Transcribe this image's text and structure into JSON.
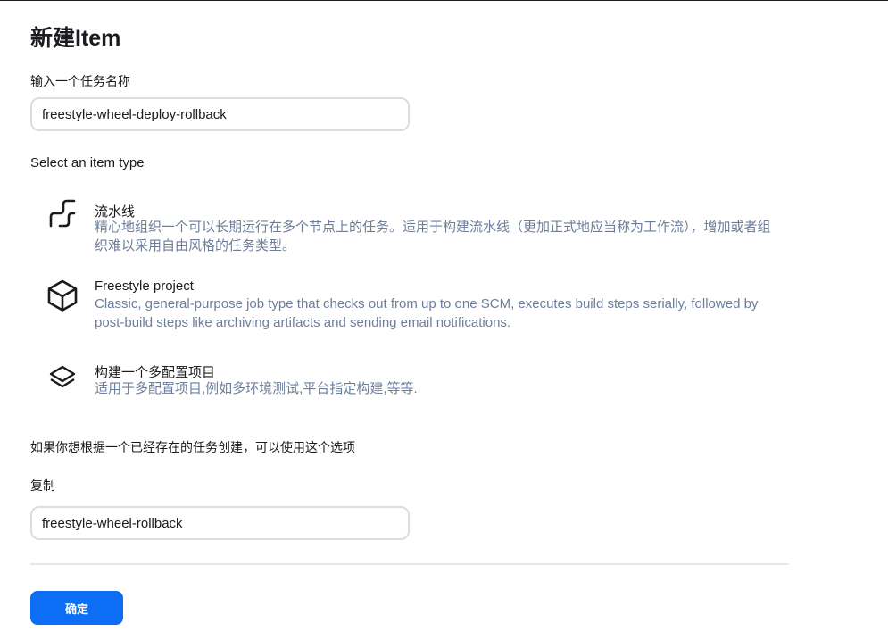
{
  "page": {
    "title": "新建Item"
  },
  "name_field": {
    "label": "输入一个任务名称",
    "value": "freestyle-wheel-deploy-rollback"
  },
  "item_types": {
    "section_label": "Select an item type",
    "items": [
      {
        "name": "流水线",
        "description": "精心地组织一个可以长期运行在多个节点上的任务。适用于构建流水线（更加正式地应当称为工作流），增加或者组织难以采用自由风格的任务类型。",
        "icon": "pipeline-icon"
      },
      {
        "name": "Freestyle project",
        "description": "Classic, general-purpose job type that checks out from up to one SCM, executes build steps serially, followed by post-build steps like archiving artifacts and sending email notifications.",
        "icon": "freestyle-box-icon"
      },
      {
        "name": "构建一个多配置项目",
        "description": "适用于多配置项目,例如多环境测试,平台指定构建,等等.",
        "icon": "layers-icon"
      }
    ]
  },
  "copy_section": {
    "hint": "如果你想根据一个已经存在的任务创建，可以使用这个选项",
    "label": "复制",
    "value": "freestyle-wheel-rollback"
  },
  "footer": {
    "ok_label": "确定"
  },
  "colors": {
    "accent": "#0b6ef5",
    "description_text": "#6d7e9b",
    "border": "#dcdde3"
  }
}
